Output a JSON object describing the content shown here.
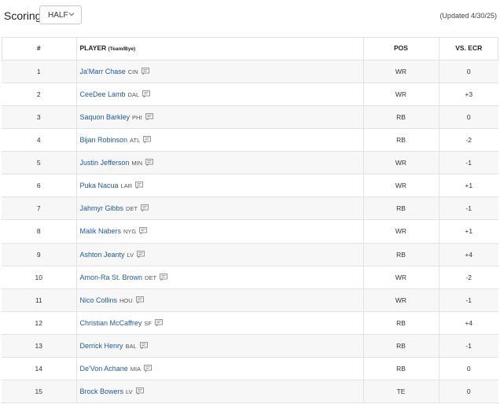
{
  "header": {
    "scoring_label": "Scoring",
    "scoring_value": "HALF",
    "updated": "(Updated 4/30/25)"
  },
  "table": {
    "columns": {
      "rank": "#",
      "player": "PLAYER",
      "player_sub": "(Team/Bye)",
      "pos": "POS",
      "ecr": "VS. ECR"
    },
    "rows": [
      {
        "rank": "1",
        "name": "Ja'Marr Chase",
        "team": "CIN",
        "pos": "WR",
        "ecr": "0"
      },
      {
        "rank": "2",
        "name": "CeeDee Lamb",
        "team": "DAL",
        "pos": "WR",
        "ecr": "+3"
      },
      {
        "rank": "3",
        "name": "Saquon Barkley",
        "team": "PHI",
        "pos": "RB",
        "ecr": "0"
      },
      {
        "rank": "4",
        "name": "Bijan Robinson",
        "team": "ATL",
        "pos": "RB",
        "ecr": "-2"
      },
      {
        "rank": "5",
        "name": "Justin Jefferson",
        "team": "MIN",
        "pos": "WR",
        "ecr": "-1"
      },
      {
        "rank": "6",
        "name": "Puka Nacua",
        "team": "LAR",
        "pos": "WR",
        "ecr": "+1"
      },
      {
        "rank": "7",
        "name": "Jahmyr Gibbs",
        "team": "DET",
        "pos": "RB",
        "ecr": "-1"
      },
      {
        "rank": "8",
        "name": "Malik Nabers",
        "team": "NYG",
        "pos": "WR",
        "ecr": "+1"
      },
      {
        "rank": "9",
        "name": "Ashton Jeanty",
        "team": "LV",
        "pos": "RB",
        "ecr": "+4"
      },
      {
        "rank": "10",
        "name": "Amon-Ra St. Brown",
        "team": "DET",
        "pos": "WR",
        "ecr": "-2"
      },
      {
        "rank": "11",
        "name": "Nico Collins",
        "team": "HOU",
        "pos": "WR",
        "ecr": "-1"
      },
      {
        "rank": "12",
        "name": "Christian McCaffrey",
        "team": "SF",
        "pos": "RB",
        "ecr": "+4"
      },
      {
        "rank": "13",
        "name": "Derrick Henry",
        "team": "BAL",
        "pos": "RB",
        "ecr": "-1"
      },
      {
        "rank": "14",
        "name": "De'Von Achane",
        "team": "MIA",
        "pos": "RB",
        "ecr": "0"
      },
      {
        "rank": "15",
        "name": "Brock Bowers",
        "team": "LV",
        "pos": "TE",
        "ecr": "0"
      }
    ]
  },
  "colors": {
    "link": "#1f5aa6",
    "row_alt": "#f7f7f7",
    "border": "#e2e2e2"
  },
  "icons": {
    "note": "comment-icon",
    "dropdown": "chevron-down-icon"
  }
}
